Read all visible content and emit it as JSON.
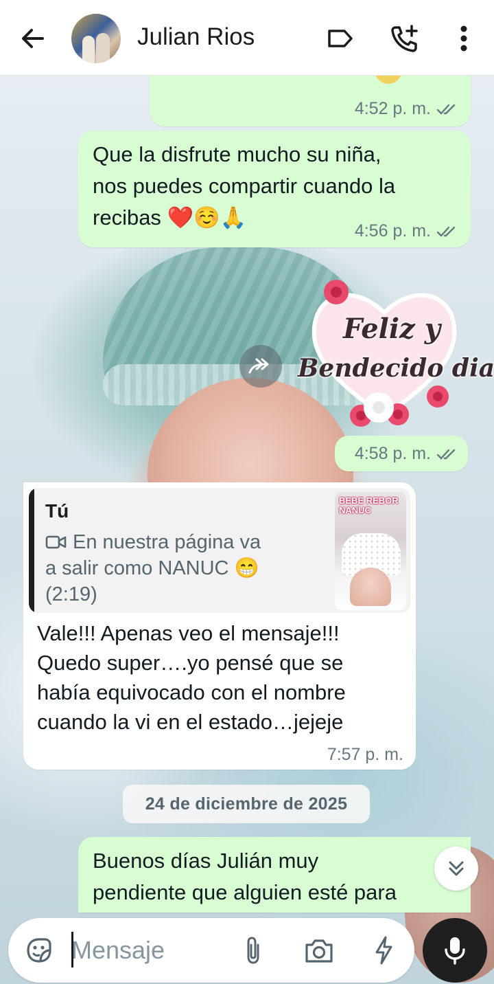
{
  "header": {
    "contact_name": "Julian Rios",
    "icons": [
      "back-arrow-icon",
      "label-icon",
      "add-call-icon",
      "more-vert-icon"
    ]
  },
  "messages": [
    {
      "direction": "out",
      "type": "text",
      "text": "",
      "time": "4:52 p. m.",
      "status": "read"
    },
    {
      "direction": "out",
      "type": "text",
      "lines": [
        "Que la disfrute mucho  su niña,",
        "nos puedes compartir cuando la",
        "recibas ❤️☺️🙏"
      ],
      "time": "4:56 p. m.",
      "status": "read"
    },
    {
      "direction": "out",
      "type": "sticker",
      "sticker_lines": [
        "Feliz y",
        "Bendecido dia"
      ],
      "time": "4:58 p. m.",
      "status": "read"
    },
    {
      "direction": "in",
      "type": "reply",
      "quote": {
        "author": "Tú",
        "lines": [
          "En nuestra página va",
          "a salir como NANUC 😁",
          "(2:19)"
        ],
        "thumb_label": "BEBE REBOR NANUC"
      },
      "lines": [
        "Vale!!! Apenas veo el mensaje!!!",
        "Quedo super….yo pensé que se",
        "había equivocado con el nombre",
        "cuando la vi en el estado…jejeje"
      ],
      "time": "7:57 p. m."
    },
    {
      "direction": "out",
      "type": "text",
      "lines": [
        "Buenos días Julián muy",
        "pendiente que alguien esté  para"
      ],
      "time": "",
      "status": ""
    }
  ],
  "date_separator": "24 de diciembre de 2025",
  "composer": {
    "placeholder": "Mensaje",
    "icons": [
      "sticker-icon",
      "attach-icon",
      "camera-icon",
      "lightning-icon",
      "mic-icon"
    ]
  },
  "colors": {
    "outgoing_bubble": "#d9fdd3",
    "incoming_bubble": "#ffffff",
    "mic_button": "#1f1f1f"
  }
}
